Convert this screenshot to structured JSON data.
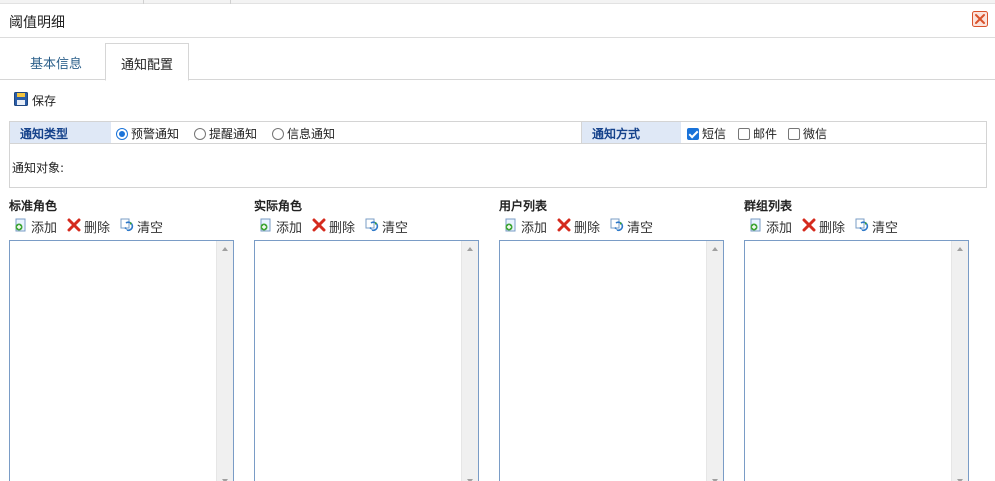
{
  "window": {
    "title": "阈值明细",
    "close_icon": "close-icon"
  },
  "tabs": [
    {
      "label": "基本信息",
      "active": false
    },
    {
      "label": "通知配置",
      "active": true
    }
  ],
  "toolbar": {
    "save_label": "保存",
    "save_icon": "floppy-disk-icon"
  },
  "form": {
    "notify_type_label": "通知类型",
    "notify_type_options": [
      {
        "label": "预警通知",
        "selected": true
      },
      {
        "label": "提醒通知",
        "selected": false
      },
      {
        "label": "信息通知",
        "selected": false
      }
    ],
    "notify_method_label": "通知方式",
    "notify_method_options": [
      {
        "label": "短信",
        "checked": true
      },
      {
        "label": "邮件",
        "checked": false
      },
      {
        "label": "微信",
        "checked": false
      }
    ],
    "notify_target_label": "通知对象:"
  },
  "panels": [
    {
      "title": "标准角色",
      "add": "添加",
      "delete": "删除",
      "clear": "清空"
    },
    {
      "title": "实际角色",
      "add": "添加",
      "delete": "删除",
      "clear": "清空"
    },
    {
      "title": "用户列表",
      "add": "添加",
      "delete": "删除",
      "clear": "清空"
    },
    {
      "title": "群组列表",
      "add": "添加",
      "delete": "删除",
      "clear": "清空"
    }
  ],
  "colors": {
    "header_bg": "#dfe8f6",
    "header_text": "#15428b",
    "accent": "#1a73d9",
    "close": "#d9532c"
  }
}
